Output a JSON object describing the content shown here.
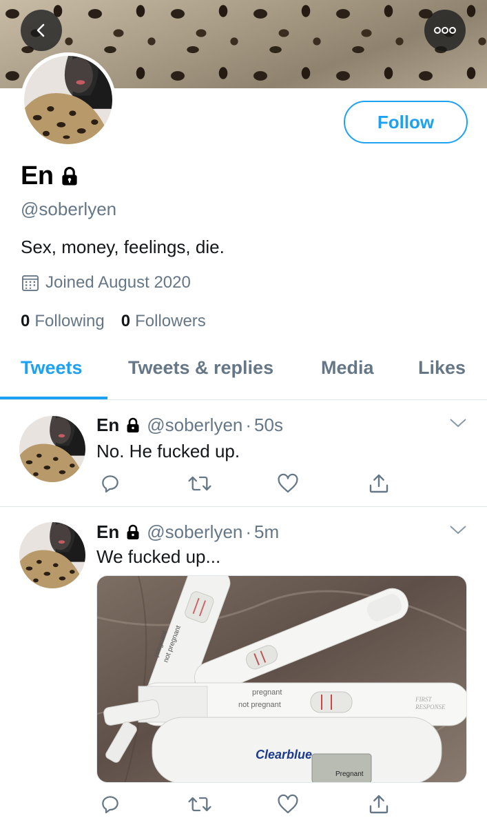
{
  "profile": {
    "display_name": "En",
    "handle": "@soberlyen",
    "bio": "Sex, money, feelings, die.",
    "joined": "Joined August 2020",
    "following_count": "0",
    "following_label": "Following",
    "followers_count": "0",
    "followers_label": "Followers",
    "follow_label": "Follow"
  },
  "tabs": [
    {
      "label": "Tweets",
      "active": true
    },
    {
      "label": "Tweets & replies",
      "active": false
    },
    {
      "label": "Media",
      "active": false
    },
    {
      "label": "Likes",
      "active": false
    }
  ],
  "tweets": [
    {
      "name": "En",
      "handle": "@soberlyen",
      "separator": "·",
      "time": "50s",
      "text": "No. He fucked up."
    },
    {
      "name": "En",
      "handle": "@soberlyen",
      "separator": "·",
      "time": "5m",
      "text": "We fucked up...",
      "media": {
        "test_labels": [
          "pregnant",
          "not pregnant"
        ],
        "brand_1": "Clearblue",
        "brand_1_screen": "Pregnant",
        "brand_2_line_1": "FIRST",
        "brand_2_line_2": "RESPONSE"
      }
    }
  ],
  "icons": {
    "back": "chevron-left-icon",
    "more": "more-dots-icon",
    "lock": "lock-icon",
    "calendar": "calendar-icon",
    "reply": "reply-icon",
    "retweet": "retweet-icon",
    "like": "heart-icon",
    "share": "share-icon",
    "caret": "chevron-down-icon"
  },
  "colors": {
    "accent": "#1da1f2",
    "secondary_text": "#657786",
    "primary_text": "#14171a",
    "divider": "#e1e8ed"
  }
}
